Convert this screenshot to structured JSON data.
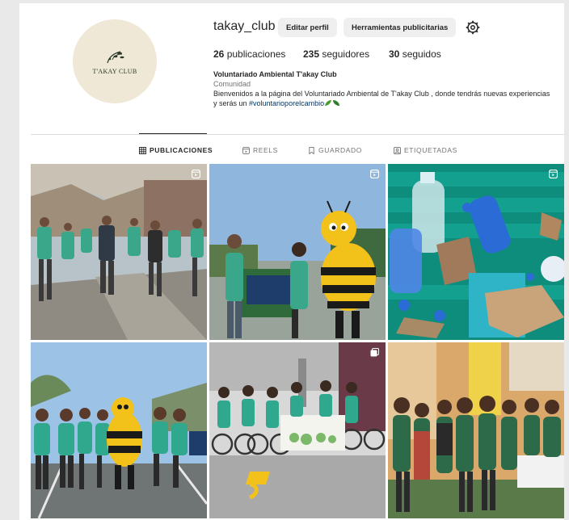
{
  "profile": {
    "username": "takay_club",
    "avatar_text": "T'AKAY CLUB",
    "edit_label": "Editar perfil",
    "tools_label": "Herramientas publicitarias",
    "settings_icon": "gear-icon"
  },
  "stats": {
    "posts_count": "26",
    "posts_label": "publicaciones",
    "followers_count": "235",
    "followers_label": "seguidores",
    "following_count": "30",
    "following_label": "seguidos"
  },
  "bio": {
    "name": "Voluntariado Ambiental T'akay Club",
    "category": "Comunidad",
    "text": "Bienvenidos a la página del Voluntariado Ambiental de T'akay Club , donde tendrás nuevas experiencias y serás un ",
    "hashtag": "#voluntarioporelcambio"
  },
  "tabs": [
    {
      "label": "PUBLICACIONES",
      "icon": "grid-icon",
      "active": true
    },
    {
      "label": "REELS",
      "icon": "reels-icon",
      "active": false
    },
    {
      "label": "GUARDADO",
      "icon": "bookmark-icon",
      "active": false
    },
    {
      "label": "ETIQUETADAS",
      "icon": "tagged-icon",
      "active": false
    }
  ],
  "posts": [
    {
      "badge": "reel-icon"
    },
    {
      "badge": "reel-icon"
    },
    {
      "badge": "reel-icon"
    },
    {
      "badge": ""
    },
    {
      "badge": "carousel-icon"
    },
    {
      "badge": ""
    }
  ],
  "colors": {
    "accent_green": "#3aa68a",
    "link": "#00376b",
    "button_bg": "#efefef"
  }
}
